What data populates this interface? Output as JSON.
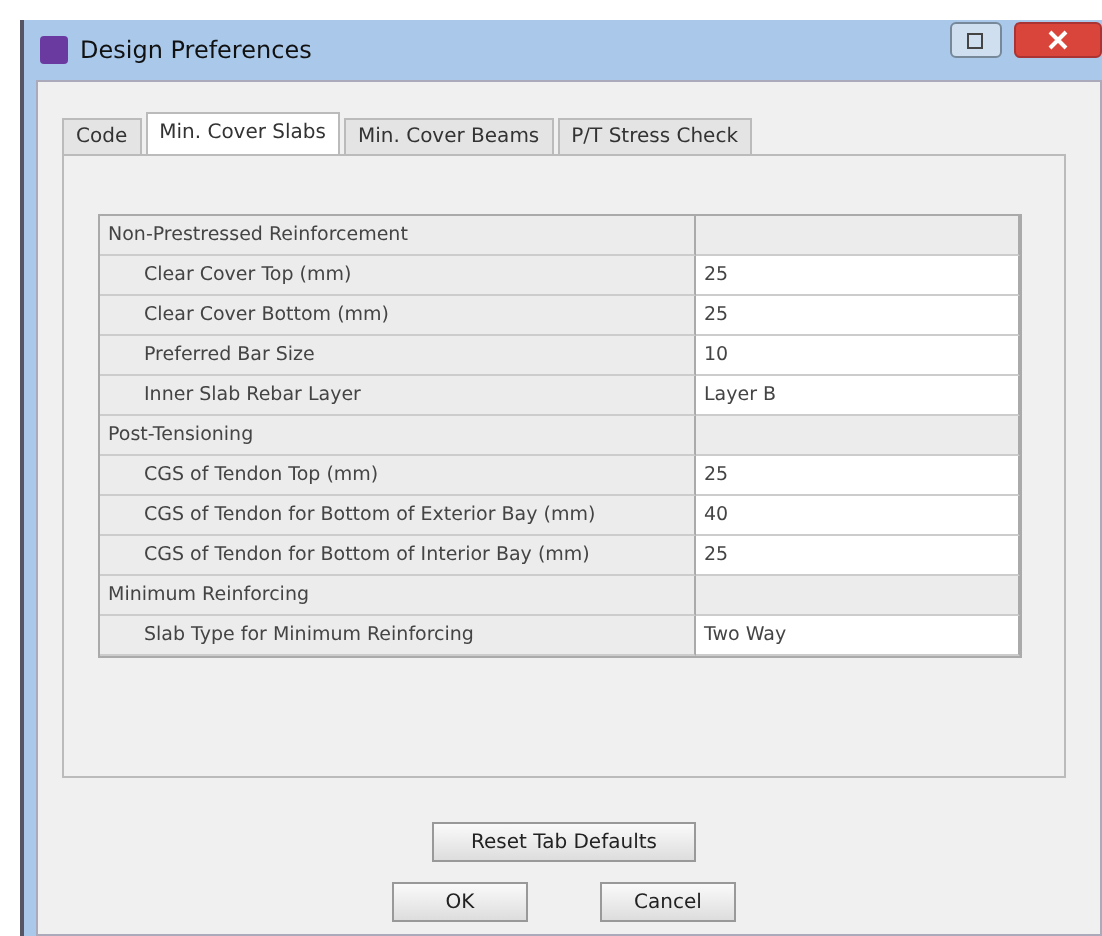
{
  "window": {
    "title": "Design Preferences"
  },
  "tabs": [
    {
      "label": "Code",
      "selected": false
    },
    {
      "label": "Min. Cover Slabs",
      "selected": true
    },
    {
      "label": "Min. Cover Beams",
      "selected": false
    },
    {
      "label": "P/T Stress Check",
      "selected": false
    }
  ],
  "table": {
    "rows": [
      {
        "kind": "section",
        "label": "Non-Prestressed Reinforcement"
      },
      {
        "kind": "item",
        "label": "Clear Cover Top  (mm)",
        "value": "25"
      },
      {
        "kind": "item",
        "label": "Clear Cover Bottom  (mm)",
        "value": "25"
      },
      {
        "kind": "item",
        "label": "Preferred Bar Size",
        "value": "10"
      },
      {
        "kind": "item",
        "label": "Inner Slab Rebar Layer",
        "value": "Layer B"
      },
      {
        "kind": "section",
        "label": "Post-Tensioning"
      },
      {
        "kind": "item",
        "label": "CGS of Tendon Top  (mm)",
        "value": "25"
      },
      {
        "kind": "item",
        "label": "CGS of Tendon for Bottom of Exterior Bay  (mm)",
        "value": "40"
      },
      {
        "kind": "item",
        "label": "CGS of Tendon for Bottom of Interior Bay  (mm)",
        "value": "25"
      },
      {
        "kind": "section",
        "label": "Minimum Reinforcing"
      },
      {
        "kind": "item",
        "label": "Slab Type for Minimum Reinforcing",
        "value": "Two Way"
      }
    ]
  },
  "buttons": {
    "reset": "Reset Tab Defaults",
    "ok": "OK",
    "cancel": "Cancel"
  }
}
